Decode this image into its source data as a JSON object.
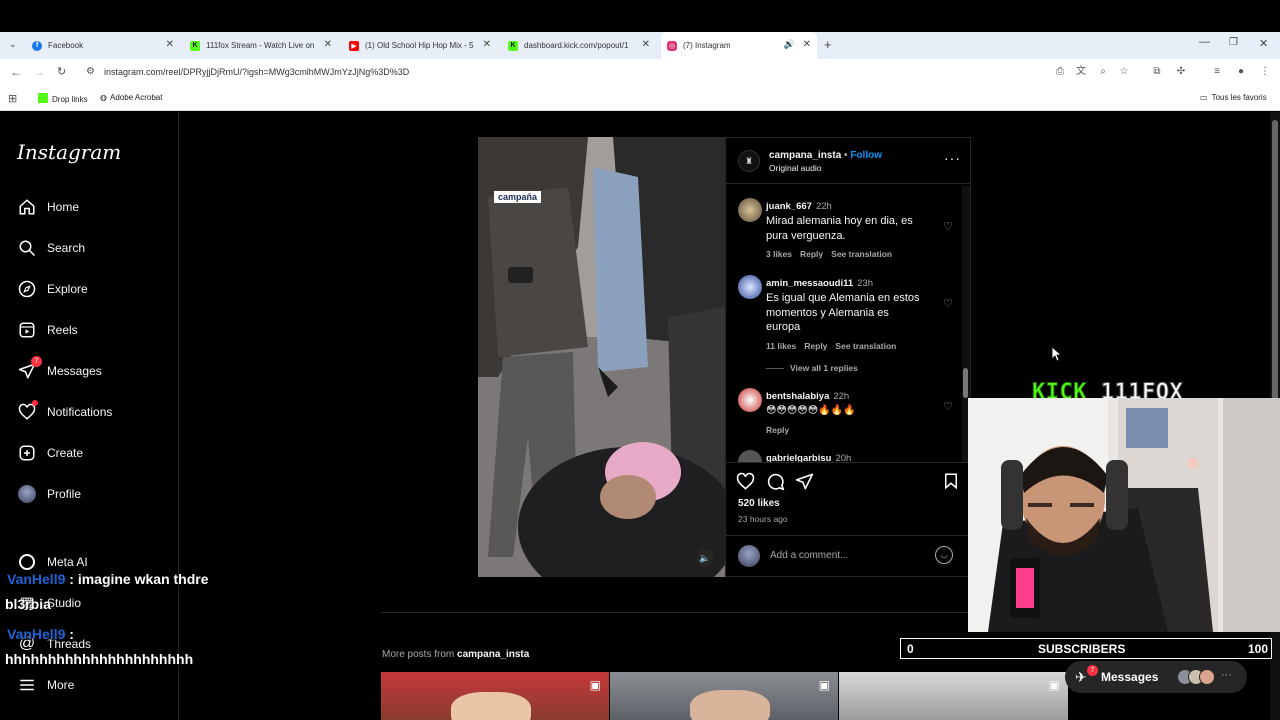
{
  "browser": {
    "tabs": [
      {
        "title": "Facebook",
        "favicon": "facebook-icon",
        "color": "#1877f2"
      },
      {
        "title": "111fox Stream - Watch Live on",
        "favicon": "kick-icon",
        "color": "#53fc18"
      },
      {
        "title": "(1) Old School Hip Hop Mix - 5",
        "favicon": "youtube-icon",
        "color": "#ff0000"
      },
      {
        "title": "dashboard.kick.com/popout/1",
        "favicon": "kick-icon",
        "color": "#53fc18"
      },
      {
        "title": "(7) Instagram",
        "favicon": "instagram-icon",
        "color": "#e1306c"
      }
    ],
    "url": "instagram.com/reel/DPRyjjDjRmU/?igsh=MWg3cmlhMWJmYzJjNg%3D%3D",
    "bookmarks": [
      "Drop links",
      "Adobe Acrobat"
    ],
    "all_bookmarks": "Tous les favoris"
  },
  "instagram": {
    "logo": "Instagram",
    "nav": [
      {
        "label": "Home",
        "icon": "home-icon"
      },
      {
        "label": "Search",
        "icon": "search-icon"
      },
      {
        "label": "Explore",
        "icon": "compass-icon"
      },
      {
        "label": "Reels",
        "icon": "reels-icon"
      },
      {
        "label": "Messages",
        "icon": "send-icon",
        "badge": "7"
      },
      {
        "label": "Notifications",
        "icon": "heart-icon"
      },
      {
        "label": "Create",
        "icon": "plus-icon"
      },
      {
        "label": "Profile",
        "icon": "avatar-icon"
      }
    ],
    "bottom_nav": [
      {
        "label": "Meta AI",
        "icon": "meta-ai-icon"
      },
      {
        "label": "Studio",
        "icon": "studio-icon"
      },
      {
        "label": "Threads",
        "icon": "threads-icon"
      },
      {
        "label": "More",
        "icon": "menu-icon"
      }
    ],
    "post": {
      "video_watermark": "campaña",
      "author": "campana_insta",
      "follow": "Follow",
      "audio": "Original audio",
      "comments": [
        {
          "user": "juank_667",
          "time": "22h",
          "lines": [
            "Mirad alemania hoy en dia, es",
            "pura verguenza."
          ],
          "likes": "3 likes",
          "reply": "Reply",
          "translate": "See translation"
        },
        {
          "user": "amin_messaoudi11",
          "time": "23h",
          "lines": [
            "Es igual que Alemania en estos",
            "momentos y Alemania es",
            "europa"
          ],
          "likes": "11 likes",
          "reply": "Reply",
          "translate": "See translation",
          "view_replies": "View all 1 replies"
        },
        {
          "user": "bentshalabiya",
          "time": "22h",
          "lines": [
            "😳😳😳😳😳🔥🔥🔥"
          ],
          "reply": "Reply"
        },
        {
          "user": "gabrielgarbisu",
          "time": "20h",
          "lines": []
        }
      ],
      "likes": "520 likes",
      "posted": "23 hours ago",
      "add_comment_placeholder": "Add a comment..."
    },
    "more_posts_prefix": "More posts from",
    "more_posts_user": "campana_insta",
    "messages_pill": "Messages",
    "messages_badge": "7"
  },
  "stream_overlay": {
    "kick_logo": "KICK",
    "channel": "111FOX",
    "subs_current": "0",
    "subs_label": "SUBSCRIBERS",
    "subs_goal": "100",
    "chat": [
      {
        "user": "VanHell9",
        "message": " : imagine wkan thdre"
      },
      {
        "user": "",
        "message": "bl3rbia"
      },
      {
        "user": "VanHell9",
        "message": " :"
      },
      {
        "user": "",
        "message": "hhhhhhhhhhhhhhhhhhhhhh"
      }
    ]
  }
}
